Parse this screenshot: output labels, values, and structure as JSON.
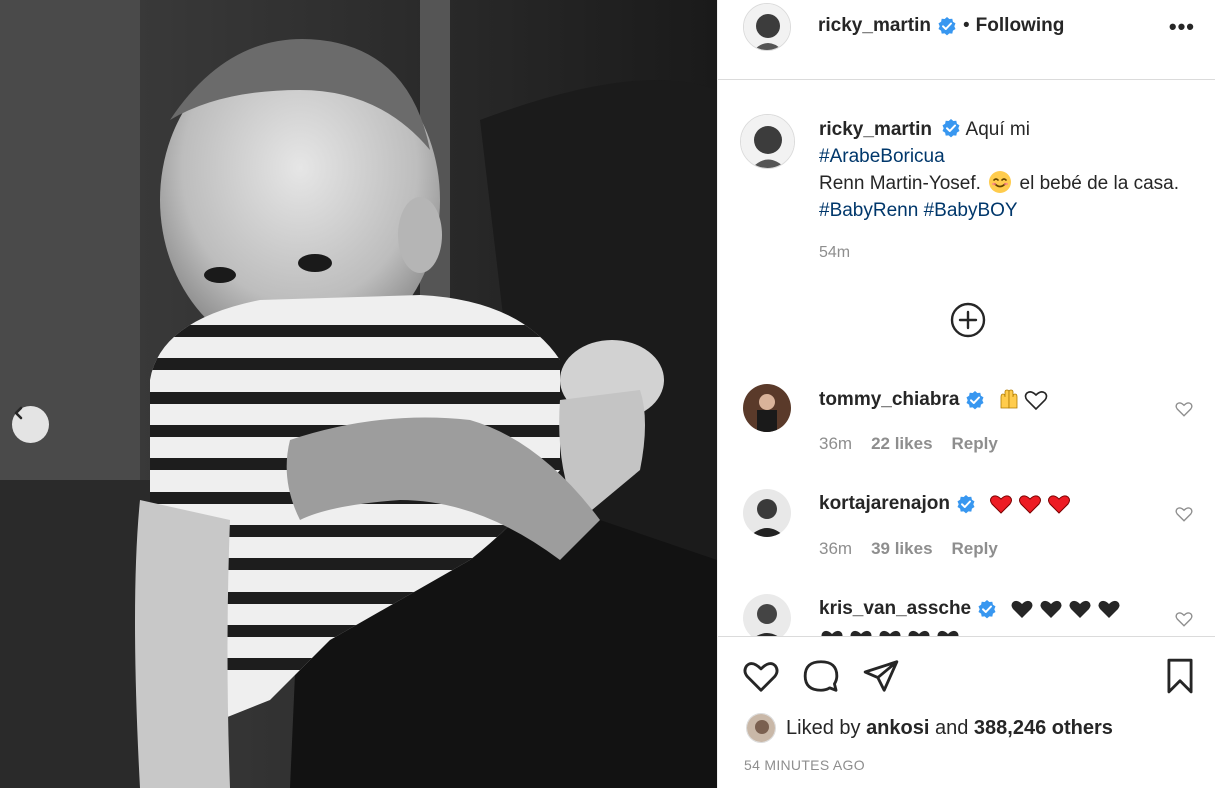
{
  "post": {
    "image_alt": "Black and white photo of a baby in a striped onesie held on a lap"
  },
  "header": {
    "username": "ricky_martin",
    "dot": "•",
    "follow_state": "Following",
    "more": "•••"
  },
  "caption": {
    "username": "ricky_martin",
    "line1": "Aquí mi",
    "hashtag1": "#ArabeBoricua",
    "line2": "Renn Martin-Yosef.",
    "line3": "el bebé de la casa.",
    "hashtag2": "#BabyRenn",
    "hashtag3": "#BabyBOY",
    "time": "54m"
  },
  "comments": [
    {
      "username": "tommy_chiabra",
      "time": "36m",
      "likes": "22 likes",
      "reply": "Reply"
    },
    {
      "username": "kortajarenajon",
      "time": "36m",
      "likes": "39 likes",
      "reply": "Reply"
    },
    {
      "username": "kris_van_assche",
      "time": "",
      "likes": "",
      "reply": ""
    }
  ],
  "footer": {
    "liked_prefix": "Liked by",
    "liked_user": "ankosi",
    "liked_and": "and",
    "liked_count": "388,246 others",
    "timestamp": "54 MINUTES AGO"
  },
  "colors": {
    "verified": "#3897f0",
    "link": "#00376b",
    "muted": "#8e8e8e",
    "red_heart": "#ed1c24",
    "black_heart": "#262626"
  }
}
